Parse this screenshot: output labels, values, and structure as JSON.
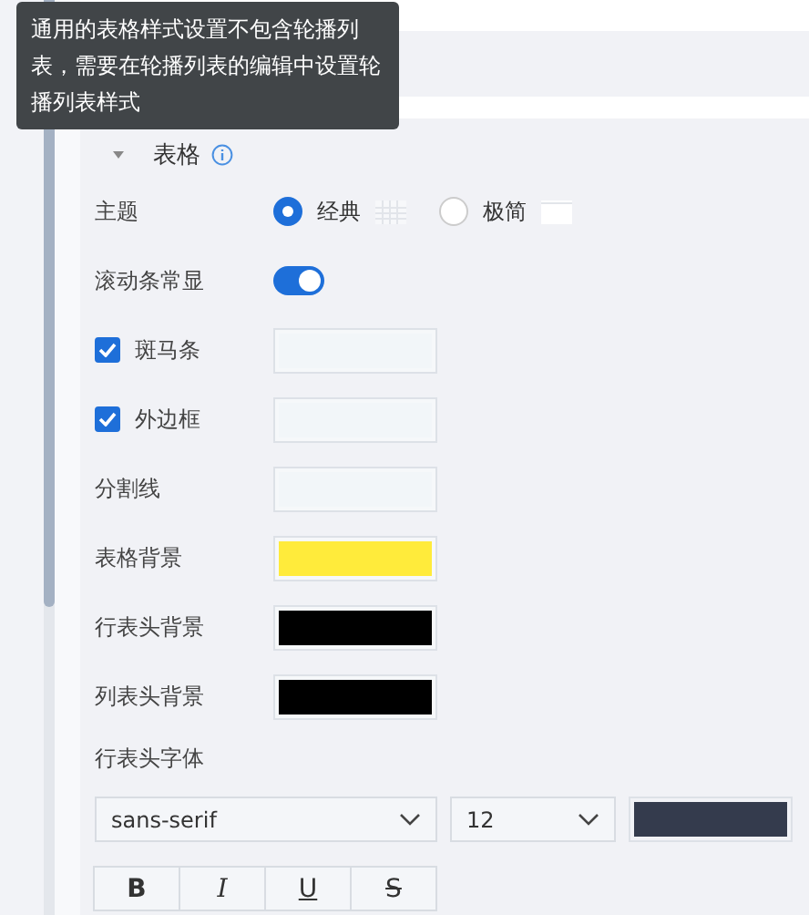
{
  "tooltip": {
    "text": "通用的表格样式设置不包含轮播列表，需要在轮播列表的编辑中设置轮播列表样式"
  },
  "section": {
    "title": "表格",
    "expanded": true
  },
  "rows": [
    {
      "kind": "radio",
      "label": "主题",
      "options": [
        {
          "label": "经典",
          "selected": true,
          "kind": "grid"
        },
        {
          "label": "极简",
          "selected": false,
          "kind": "plain"
        }
      ]
    },
    {
      "kind": "toggle",
      "label": "滚动条常显",
      "on": true
    },
    {
      "kind": "checkbox-color",
      "label": "斑马条",
      "checked": true,
      "color": "#f2f6f9"
    },
    {
      "kind": "checkbox-color",
      "label": "外边框",
      "checked": true,
      "color": "#f2f6f9"
    },
    {
      "kind": "color",
      "label": "分割线",
      "color": "#f2f6f9"
    },
    {
      "kind": "color",
      "label": "表格背景",
      "color": "#ffeb3b"
    },
    {
      "kind": "color",
      "label": "行表头背景",
      "color": "#000000"
    },
    {
      "kind": "color",
      "label": "列表头背景",
      "color": "#000000"
    },
    {
      "kind": "heading",
      "label": "行表头字体"
    }
  ],
  "font": {
    "family": "sans-serif",
    "size": "12",
    "color": "#343b4d"
  },
  "styles": [
    {
      "kind": "bold",
      "label": "B"
    },
    {
      "kind": "italic",
      "label": "I"
    },
    {
      "kind": "underline",
      "label": "U"
    },
    {
      "kind": "strike",
      "label": "S"
    }
  ]
}
